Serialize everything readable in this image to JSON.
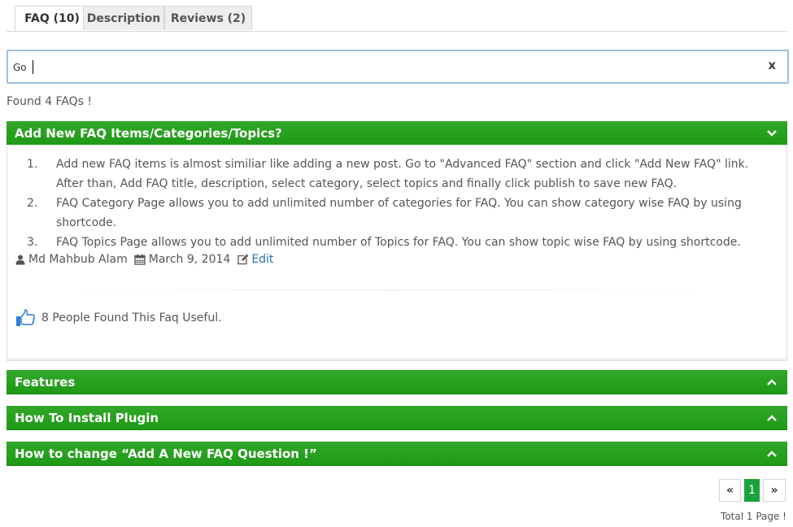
{
  "tabs": [
    {
      "label": "FAQ (10)",
      "active": true
    },
    {
      "label": "Description",
      "active": false
    },
    {
      "label": "Reviews (2)",
      "active": false
    }
  ],
  "search": {
    "value": "Go",
    "clear_label": "x"
  },
  "found_text": "Found 4 FAQs !",
  "faqs": [
    {
      "title": "Add New FAQ Items/Categories/Topics?",
      "expanded": true,
      "items": [
        {
          "num": "1.",
          "text": "Add new FAQ items is almost similiar like adding a new post. Go to \"Advanced FAQ\" section and click \"Add New FAQ\" link. After than, Add FAQ title, description, select category, select topics and finally click publish to save new FAQ."
        },
        {
          "num": "2.",
          "text": "FAQ Category Page allows you to add unlimited number of categories for FAQ. You can show category wise FAQ by using shortcode."
        },
        {
          "num": "3.",
          "text": "FAQ Topics Page allows you to add unlimited number of Topics for FAQ. You can show topic wise FAQ by using shortcode."
        }
      ],
      "author": "Md Mahbub Alam",
      "date": "March 9, 2014",
      "edit_label": "Edit",
      "useful_text": "8 People Found This Faq Useful."
    },
    {
      "title": "Features",
      "expanded": false
    },
    {
      "title": "How To Install Plugin",
      "expanded": false
    },
    {
      "title": "How to change “Add A New FAQ Question !”",
      "expanded": false
    }
  ],
  "pagination": {
    "prev": "«",
    "current": "1",
    "next": "»",
    "total_text": "Total 1 Page !"
  },
  "colors": {
    "accent_green": "#1f9a17",
    "link_blue": "#2a6fa8",
    "search_border": "#9cc0e3"
  }
}
